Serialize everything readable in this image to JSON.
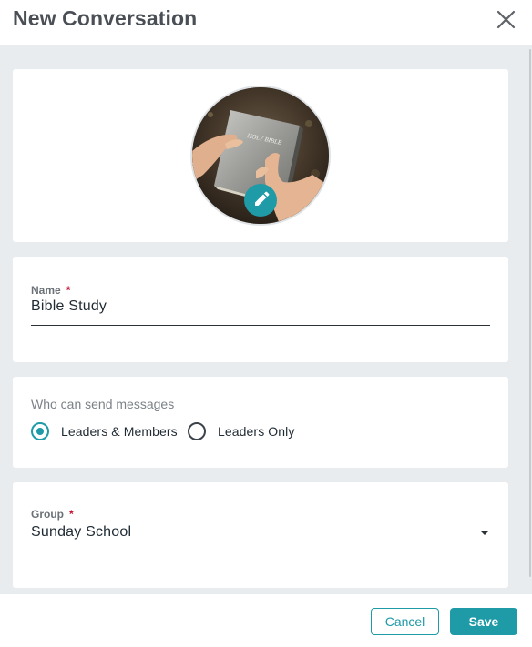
{
  "dialog": {
    "title": "New Conversation",
    "close_icon": "close-icon"
  },
  "photo": {
    "image_subject": "hands holding a Bible",
    "book_text": "HOLY BIBLE",
    "edit_icon": "pencil-icon"
  },
  "name_field": {
    "label": "Name",
    "required_mark": "*",
    "value": "Bible Study"
  },
  "permissions": {
    "label": "Who can send messages",
    "options": [
      {
        "label": "Leaders & Members",
        "selected": true
      },
      {
        "label": "Leaders Only",
        "selected": false
      }
    ]
  },
  "group_field": {
    "label": "Group",
    "required_mark": "*",
    "value": "Sunday School",
    "dropdown_icon": "caret-down-icon"
  },
  "footer": {
    "cancel_label": "Cancel",
    "save_label": "Save"
  },
  "colors": {
    "accent": "#1f9aa7",
    "required": "#c8102e",
    "background": "#e9ecee",
    "title": "#4a4f55"
  }
}
